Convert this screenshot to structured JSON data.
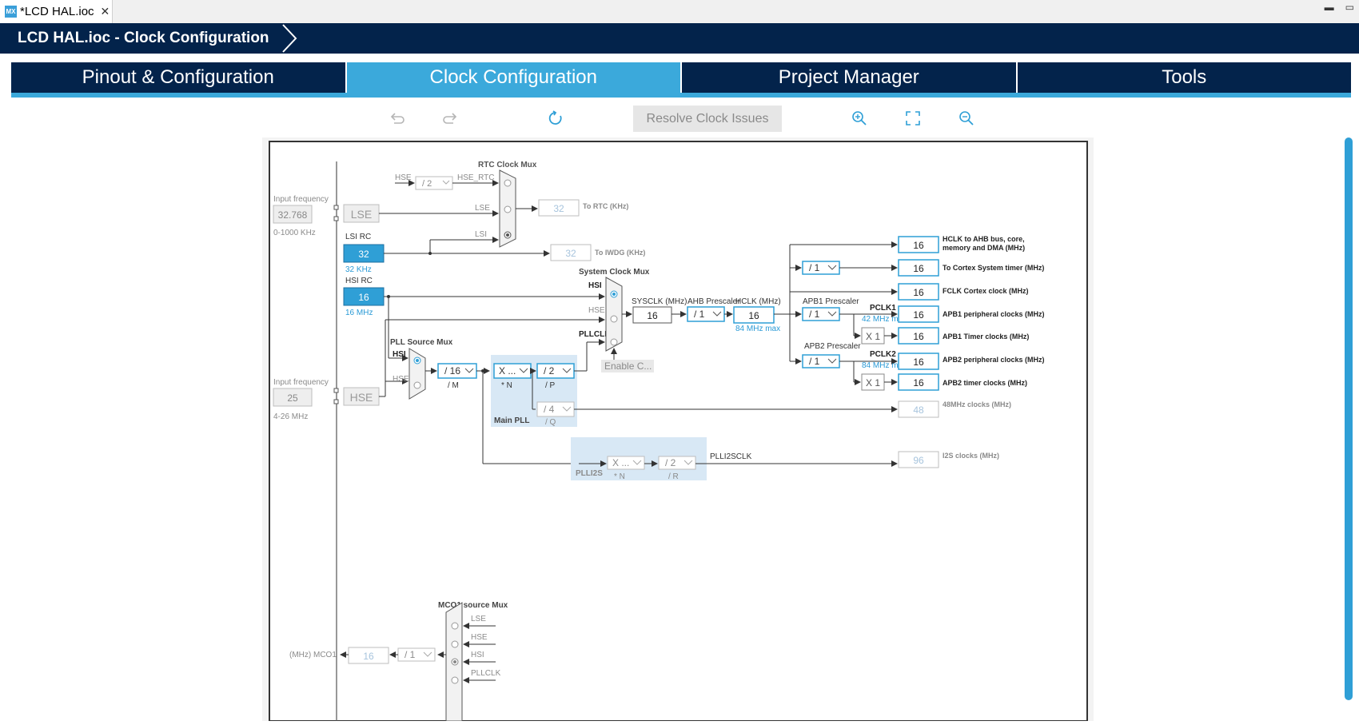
{
  "editor_tab": {
    "icon": "MX",
    "label": "*LCD HAL.ioc"
  },
  "title": "LCD HAL.ioc - Clock Configuration",
  "main_tabs": [
    "Pinout & Configuration",
    "Clock Configuration",
    "Project Manager",
    "Tools"
  ],
  "toolbar": {
    "resolve_label": "Resolve Clock Issues"
  },
  "diagram": {
    "input_frequency_label": "Input frequency",
    "lse_freq": "32.768",
    "lse_range": "0-1000 KHz",
    "lse_label": "LSE",
    "lsi_title": "LSI RC",
    "lsi_value": "32",
    "lsi_unit": "32 KHz",
    "hsi_title": "HSI RC",
    "hsi_value": "16",
    "hsi_unit": "16 MHz",
    "hse_freq": "25",
    "hse_range": "4-26 MHz",
    "hse_label": "HSE",
    "rtc_mux_title": "RTC Clock Mux",
    "rtc_hse_in": "HSE",
    "rtc_div": "/ 2",
    "rtc_hse_rtc": "HSE_RTC",
    "rtc_lse": "LSE",
    "rtc_lsi": "LSI",
    "rtc_out": "32",
    "rtc_out_label": "To RTC (KHz)",
    "iwdg_out": "32",
    "iwdg_label": "To IWDG (KHz)",
    "sys_mux_title": "System Clock Mux",
    "sys_hsi": "HSI",
    "sys_hse": "HSE",
    "sys_pllclk": "PLLCLK",
    "enable_css": "Enable C...",
    "pll_mux_title": "PLL Source Mux",
    "pll_hsi": "HSI",
    "pll_hse": "HSE",
    "pll_m": "/ 16",
    "pll_m_lbl": "/ M",
    "pll_n": "X ...",
    "pll_n_lbl": "* N",
    "pll_p": "/ 2",
    "pll_p_lbl": "/ P",
    "pll_q": "/ 4",
    "pll_q_lbl": "/ Q",
    "main_pll": "Main PLL",
    "sysclk_label": "SYSCLK (MHz)",
    "sysclk": "16",
    "ahb_label": "AHB Prescaler",
    "ahb": "/ 1",
    "hclk_label": "HCLK (MHz)",
    "hclk": "16",
    "hclk_max": "84 MHz max",
    "apb1_label": "APB1 Prescaler",
    "apb1": "/ 1",
    "pclk1": "PCLK1",
    "pclk1_max": "42 MHz max",
    "apb2_label": "APB2 Prescaler",
    "apb2": "/ 1",
    "pclk2": "PCLK2",
    "pclk2_max": "84 MHz max",
    "cortex_div": "/ 1",
    "x1a": "X 1",
    "x1b": "X 1",
    "outputs": [
      {
        "value": "16",
        "label": "HCLK to AHB bus, core,",
        "label2": "memory and DMA (MHz)"
      },
      {
        "value": "16",
        "label": "To Cortex System timer (MHz)"
      },
      {
        "value": "16",
        "label": "FCLK Cortex clock (MHz)"
      },
      {
        "value": "16",
        "label": "APB1 peripheral clocks (MHz)"
      },
      {
        "value": "16",
        "label": "APB1 Timer clocks (MHz)"
      },
      {
        "value": "16",
        "label": "APB2 peripheral clocks (MHz)"
      },
      {
        "value": "16",
        "label": "APB2 timer clocks (MHz)"
      },
      {
        "value": "48",
        "label": "48MHz clocks (MHz)"
      },
      {
        "value": "96",
        "label": "I2S clocks (MHz)"
      }
    ],
    "plli2s_title": "PLLI2S",
    "plli2s_n": "X ...",
    "plli2s_n_lbl": "* N",
    "plli2s_r": "/ 2",
    "plli2s_r_lbl": "/ R",
    "plli2sclk": "PLLI2SCLK",
    "mco_mux_title": "MCO1 source Mux",
    "mco_lse": "LSE",
    "mco_hse": "HSE",
    "mco_hsi": "HSI",
    "mco_pllclk": "PLLCLK",
    "mco_div": "/ 1",
    "mco_out": "16",
    "mco_label": "(MHz) MCO1"
  }
}
